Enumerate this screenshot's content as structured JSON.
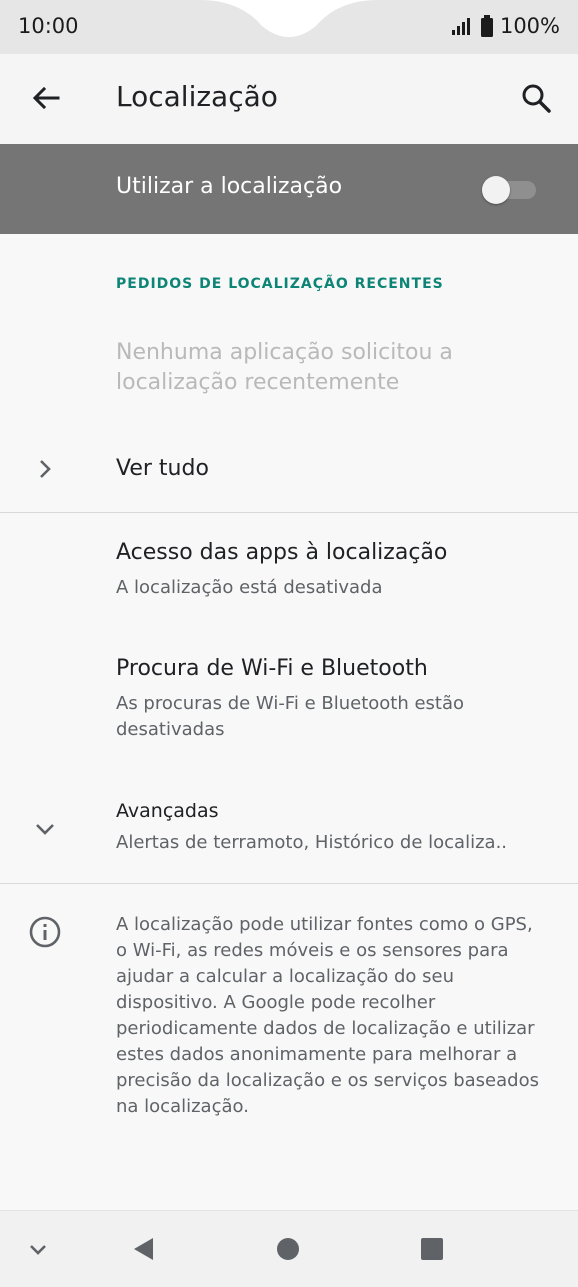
{
  "status_bar": {
    "time": "10:00",
    "battery": "100%",
    "icons": [
      "signal-icon",
      "battery-icon"
    ]
  },
  "app_bar": {
    "title": "Localização",
    "back_icon": "arrow-left-icon",
    "search_icon": "search-icon"
  },
  "master_switch": {
    "label": "Utilizar a localização",
    "enabled": false
  },
  "recent": {
    "header": "PEDIDOS DE LOCALIZAÇÃO RECENTES",
    "empty_message": "Nenhuma aplicação solicitou a localização recentemente",
    "see_all": "Ver tudo"
  },
  "settings": [
    {
      "title": "Acesso das apps à localização",
      "subtitle": "A localização está desativada"
    },
    {
      "title": "Procura de Wi-Fi e Bluetooth",
      "subtitle": "As procuras de Wi-Fi e Bluetooth estão desativadas"
    },
    {
      "title": "Avançadas",
      "subtitle": "Alertas de terramoto, Histórico de localiza.."
    }
  ],
  "info": {
    "text": "A localização pode utilizar fontes como o GPS, o Wi-Fi, as redes móveis e os sensores para ajudar a calcular a localização do seu dispositivo. A Google pode recolher periodicamente dados de localização e utilizar estes dados anonimamente para melhorar a precisão da localização e os serviços baseados na localização."
  },
  "nav_bar": {
    "icons": [
      "chevron-down-icon",
      "back-triangle-icon",
      "home-circle-icon",
      "recents-square-icon"
    ]
  },
  "colors": {
    "accent": "#0d8576",
    "master_bg": "#757575"
  }
}
